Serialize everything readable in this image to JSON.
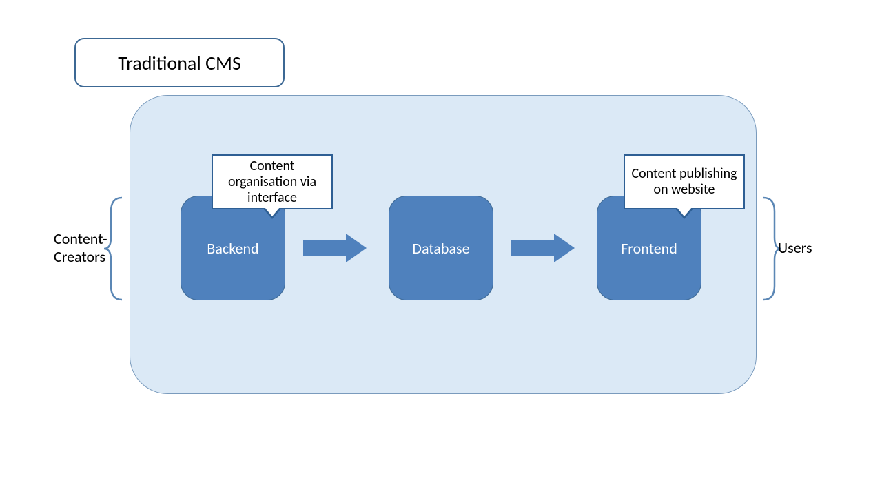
{
  "title": "Traditional CMS",
  "left_label": "Content-\nCreators",
  "right_label": "Users",
  "nodes": {
    "backend": "Backend",
    "database": "Database",
    "frontend": "Frontend"
  },
  "callouts": {
    "backend": "Content organisation via interface",
    "frontend": "Content publishing on website"
  },
  "colors": {
    "node_fill": "#4f81bd",
    "node_border": "#3c6894",
    "container_fill": "#dbe9f6",
    "container_border": "#7a9bbd",
    "callout_border": "#2e5f94",
    "bracket": "#5b87b5"
  }
}
